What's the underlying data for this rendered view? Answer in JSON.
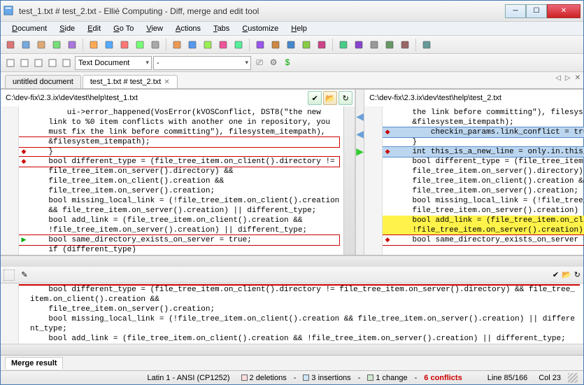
{
  "window": {
    "title": "test_1.txt # test_2.txt - Ellié Computing - Diff, merge and edit tool"
  },
  "menu": {
    "items": [
      "Document",
      "Side",
      "Edit",
      "Go To",
      "View",
      "Actions",
      "Tabs",
      "Customize",
      "Help"
    ]
  },
  "toolbar2": {
    "combo1": "Text Document",
    "combo2": "-"
  },
  "tabs": {
    "items": [
      {
        "label": "untitled document",
        "active": false,
        "closable": false
      },
      {
        "label": "test_1.txt # test_2.txt",
        "active": true,
        "closable": true
      }
    ]
  },
  "left": {
    "path": "C:\\dev-fix\\2.3.ix\\dev\\test\\help\\test_1.txt",
    "lines": [
      {
        "mk": "",
        "tx": "        ui->error_happened(VosError(kVOSConflict, DST8(\"the new"
      },
      {
        "mk": "",
        "tx": "    link to %0 item conflicts with another one in repository, you"
      },
      {
        "mk": "",
        "tx": "    must fix the link before committing\"), filesystem_itempath),"
      },
      {
        "mk": "",
        "tx": "    &filesystem_itempath);",
        "cls": "hl-redbox"
      },
      {
        "mk": "red",
        "tx": "    }"
      },
      {
        "mk": "",
        "tx": ""
      },
      {
        "mk": "red",
        "tx": "    bool different_type = (file_tree_item.on_client().directory !=",
        "cls": "hl-redbox"
      },
      {
        "mk": "",
        "tx": "    file_tree_item.on_server().directory) &&"
      },
      {
        "mk": "",
        "tx": "    file_tree_item.on_client().creation &&"
      },
      {
        "mk": "",
        "tx": "    file_tree_item.on_server().creation;"
      },
      {
        "mk": "",
        "tx": "    bool missing_local_link = (!file_tree_item.on_client().creation"
      },
      {
        "mk": "",
        "tx": "    && file_tree_item.on_server().creation) || different_type;"
      },
      {
        "mk": "",
        "tx": "    bool add_link = (file_tree_item.on_client().creation &&"
      },
      {
        "mk": "",
        "tx": "    !file_tree_item.on_server().creation) || different_type;"
      },
      {
        "mk": "green",
        "tx": "    bool same_directory_exists_on_server = true;",
        "cls": "hl-redbox"
      },
      {
        "mk": "",
        "tx": ""
      },
      {
        "mk": "",
        "tx": "    if (different_type)"
      }
    ]
  },
  "right": {
    "path": "C:\\dev-fix\\2.3.ix\\dev\\test\\help\\test_2.txt",
    "lines": [
      {
        "mk": "",
        "tx": "    the link before committing\"), filesystem_itempath),"
      },
      {
        "mk": "",
        "tx": "    &filesystem_itempath);"
      },
      {
        "mk": "red",
        "tx": "        checkin_params.link_conflict = true;",
        "cls": "hl-blue"
      },
      {
        "mk": "",
        "tx": "    }"
      },
      {
        "mk": "",
        "tx": ""
      },
      {
        "mk": "red",
        "tx": "    int this_is_a_new_line = only.in.this_file;",
        "cls": "hl-blue"
      },
      {
        "mk": "",
        "tx": ""
      },
      {
        "mk": "",
        "tx": "    bool different_type = (file_tree_item.on_client().directory !="
      },
      {
        "mk": "",
        "tx": "    file_tree_item.on_server().directory) &&"
      },
      {
        "mk": "",
        "tx": "    file_tree_item.on_client().creation &&"
      },
      {
        "mk": "",
        "tx": "    file_tree_item.on_server().creation;"
      },
      {
        "mk": "",
        "tx": "    bool missing_local_link = (!file_tree_item.on_client().creation &&"
      },
      {
        "mk": "",
        "tx": "    file_tree_item.on_server().creation) || different_type;"
      },
      {
        "mk": "",
        "tx": "    bool add_link = (file_tree_item.on_client().creation &&",
        "cls": "hl-yellow"
      },
      {
        "mk": "",
        "tx": "    !file_tree_item.on_server().creation) || different_type;",
        "cls": "hl-yellow"
      },
      {
        "mk": "red",
        "tx": "    bool same_directory_exists_on_server = false;",
        "cls": "hl-redbox"
      }
    ]
  },
  "merge": {
    "lines": [
      {
        "mk": "",
        "tx": "",
        "cls": "hl-redbox"
      },
      {
        "mk": "",
        "tx": "    bool different_type = (file_tree_item.on_client().directory != file_tree_item.on_server().directory) && file_tree_item.on_client().creation &&"
      },
      {
        "mk": "",
        "tx": "    file_tree_item.on_server().creation;"
      },
      {
        "mk": "",
        "tx": "    bool missing_local_link = (!file_tree_item.on_client().creation && file_tree_item.on_server().creation) || different_type;"
      },
      {
        "mk": "",
        "tx": "    bool add_link = (file_tree_item.on_client().creation && !file_tree_item.on_server().creation) || different_type;"
      }
    ],
    "result_label": "Merge result"
  },
  "status": {
    "encoding": "Latin 1 - ANSI (CP1252)",
    "deletions": "2 deletions",
    "insertions": "3 insertions",
    "changes": "1 change",
    "conflicts": "6 conflicts",
    "line": "Line 85/166",
    "col": "Col 23"
  },
  "icons": {
    "toolbar1": [
      "new-doc",
      "zoom",
      "open",
      "copy",
      "paste",
      "save",
      "save-all",
      "undo",
      "redo",
      "swap",
      "prev-diff",
      "next-diff",
      "first-diff",
      "last-diff",
      "apply-left",
      "apply-right",
      "ignore",
      "bookmark-prev",
      "bookmark-next",
      "bookmark-toggle",
      "line-mode",
      "char-mode",
      "show-all",
      "settings",
      "filter",
      "run"
    ],
    "toolbar2_left": [
      "view-single",
      "view-split",
      "view-3way",
      "indent",
      "outdent"
    ],
    "toolbar2_right": [
      "camera",
      "gear",
      "dollar"
    ]
  }
}
